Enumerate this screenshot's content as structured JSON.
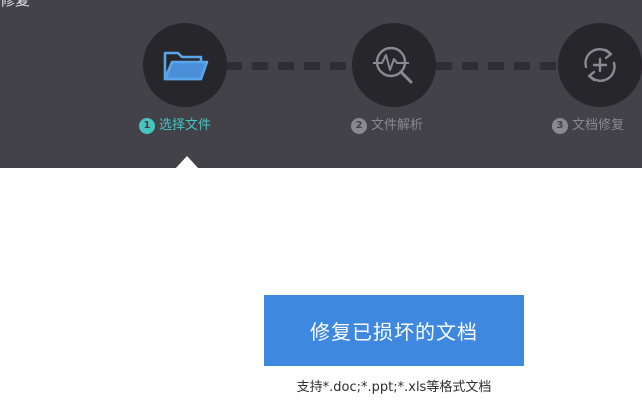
{
  "window": {
    "title": "修复"
  },
  "steps": [
    {
      "number": "1",
      "label": "选择文件",
      "icon": "folder-icon",
      "state": "active",
      "color": "#46c4c0"
    },
    {
      "number": "2",
      "label": "文件解析",
      "icon": "scan-analysis-icon",
      "state": "pending",
      "color": "#8a898f"
    },
    {
      "number": "3",
      "label": "文档修复",
      "icon": "repair-cycle-icon",
      "state": "pending",
      "color": "#8a898f"
    }
  ],
  "main": {
    "repair_button_label": "修复已损坏的文档",
    "support_text": "支持*.doc;*.ppt;*.xls等格式文档"
  },
  "colors": {
    "header_bg": "#434248",
    "circle_bg": "#27262b",
    "active_accent": "#46c4c0",
    "button_bg": "#3f88df",
    "page_bg": "#ffffff"
  }
}
